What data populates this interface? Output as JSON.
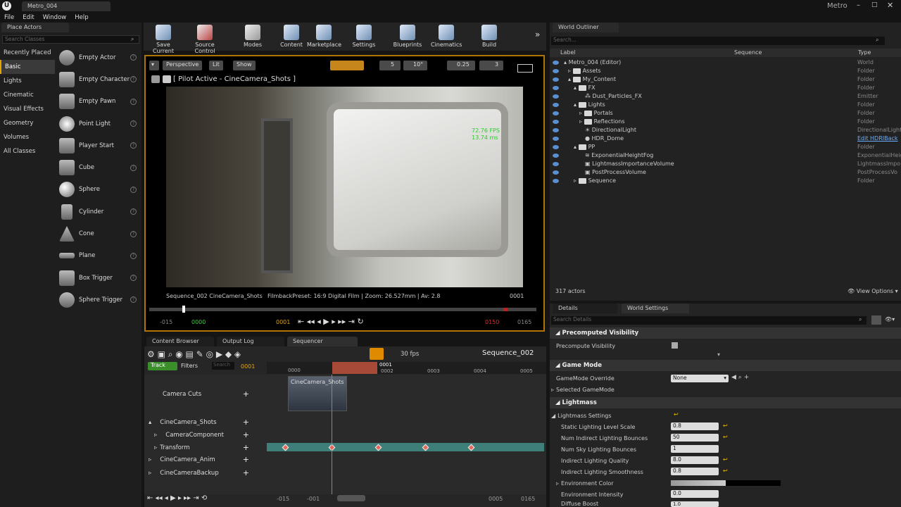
{
  "title_tab": "Metro_004",
  "project": "Metro",
  "menu": [
    "File",
    "Edit",
    "Window",
    "Help"
  ],
  "place_actors": {
    "tab": "Place Actors",
    "search_placeholder": "Search Classes",
    "categories": [
      "Recently Placed",
      "Basic",
      "Lights",
      "Cinematic",
      "Visual Effects",
      "Geometry",
      "Volumes",
      "All Classes"
    ],
    "selected": "Basic",
    "actors": [
      "Empty Actor",
      "Empty Character",
      "Empty Pawn",
      "Point Light",
      "Player Start",
      "Cube",
      "Sphere",
      "Cylinder",
      "Cone",
      "Plane",
      "Box Trigger",
      "Sphere Trigger"
    ]
  },
  "toolbar": [
    "Save Current",
    "Source Control",
    "Modes",
    "Content",
    "Marketplace",
    "Settings",
    "Blueprints",
    "Cinematics",
    "Build"
  ],
  "viewport": {
    "perspective": "Perspective",
    "lit": "Lit",
    "show": "Show",
    "pilot": "[ Pilot Active - CineCamera_Shots ]",
    "grid": "5",
    "angle": "10°",
    "scale": "0.25",
    "cam_speed": "3",
    "fps": "72.76 FPS",
    "ms": "13.74 ms",
    "sequence_label": "Sequence_002  CineCamera_Shots",
    "filmback": "FilmbackPreset: 16:9 Digital Film | Zoom: 26.527mm | Av: 2.8",
    "frame": "0001",
    "scrub": {
      "start": "-015",
      "in": "0000",
      "current": "0001",
      "out": "0150",
      "end": "0165"
    }
  },
  "bottom_tabs": [
    "Content Browser",
    "Output Log",
    "Sequencer"
  ],
  "sequencer": {
    "fps": "30 fps",
    "name": "Sequence_002",
    "track_btn": "Track",
    "filters": "Filters",
    "search_placeholder": "Search",
    "frame": "0001",
    "ruler": [
      "0000",
      "0001",
      "0002",
      "0003",
      "0004",
      "0005"
    ],
    "tracks": [
      "Camera Cuts",
      "CineCamera_Shots",
      "CameraComponent",
      "Transform",
      "CineCamera_Anim",
      "CineCameraBackup"
    ],
    "clip": "CineCamera_Shots",
    "footer": {
      "a": "-015",
      "b": "-001",
      "c": "0005",
      "d": "0165"
    }
  },
  "outliner": {
    "tab": "World Outliner",
    "search_placeholder": "Search...",
    "columns": [
      "Label",
      "Sequence",
      "Type"
    ],
    "rows": [
      {
        "label": "Metro_004 (Editor)",
        "type": "World"
      },
      {
        "label": "Assets",
        "type": "Folder"
      },
      {
        "label": "My_Content",
        "type": "Folder"
      },
      {
        "label": "FX",
        "type": "Folder"
      },
      {
        "label": "Dust_Particles_FX",
        "type": "Emitter"
      },
      {
        "label": "Lights",
        "type": "Folder"
      },
      {
        "label": "Portals",
        "type": "Folder"
      },
      {
        "label": "Reflections",
        "type": "Folder"
      },
      {
        "label": "DirectionalLight",
        "type": "DirectionalLight"
      },
      {
        "label": "HDR_Dome",
        "type": "Edit HDRIBack"
      },
      {
        "label": "PP",
        "type": "Folder"
      },
      {
        "label": "ExponentialHeightFog",
        "type": "ExponentialHeig"
      },
      {
        "label": "LightmassImportanceVolume",
        "type": "LightmassImpo"
      },
      {
        "label": "PostProcessVolume",
        "type": "PostProcessVo"
      },
      {
        "label": "Sequence",
        "type": "Folder"
      }
    ],
    "actor_count": "317 actors",
    "view_options": "View Options"
  },
  "details": {
    "tabs": [
      "Details",
      "World Settings"
    ],
    "search_placeholder": "Search Details",
    "s1": "Precomputed Visibility",
    "p1": "Precompute Visibility",
    "s2": "Game Mode",
    "p2": "GameMode Override",
    "p2v": "None",
    "p3": "Selected GameMode",
    "s3": "Lightmass",
    "p4": "Lightmass Settings",
    "props": [
      {
        "name": "Static Lighting Level Scale",
        "value": "0.8"
      },
      {
        "name": "Num Indirect Lighting Bounces",
        "value": "50"
      },
      {
        "name": "Num Sky Lighting Bounces",
        "value": "1"
      },
      {
        "name": "Indirect Lighting Quality",
        "value": "8.0"
      },
      {
        "name": "Indirect Lighting Smoothness",
        "value": "0.8"
      }
    ],
    "env_color": "Environment Color",
    "env_int": "Environment Intensity",
    "env_int_v": "0.0",
    "diffuse": "Diffuse Boost",
    "diffuse_v": "1.0"
  }
}
